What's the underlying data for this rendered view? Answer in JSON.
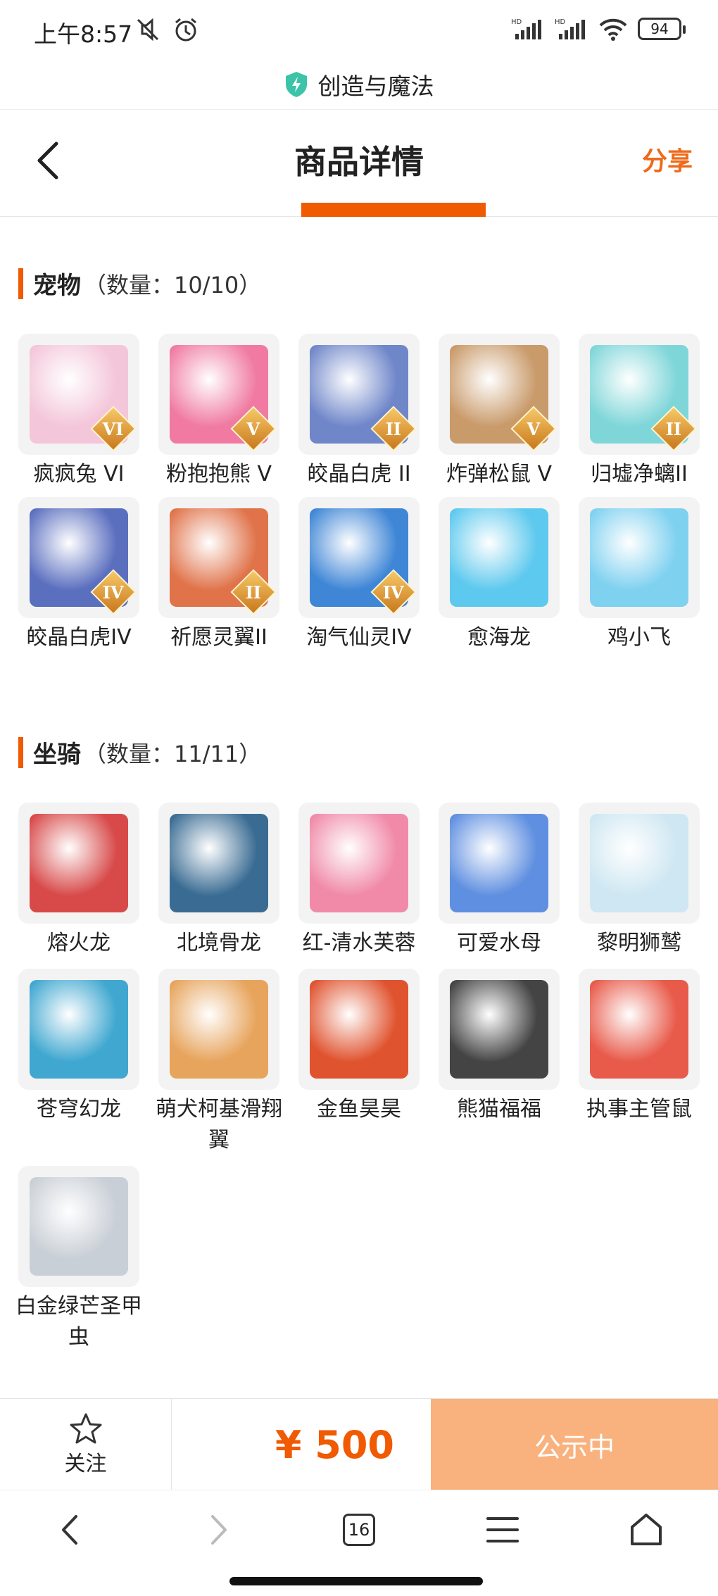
{
  "status_bar": {
    "time": "上午8:57",
    "battery": "94"
  },
  "app": {
    "title": "创造与魔法"
  },
  "header": {
    "title": "商品详情",
    "share_label": "分享"
  },
  "pets": {
    "title": "宠物",
    "count": "（数量：10/10）",
    "items": [
      {
        "name": "疯疯兔 VI",
        "badge": "VI",
        "color": "#f4c6d9"
      },
      {
        "name": "粉抱抱熊 V",
        "badge": "V",
        "color": "#f07aa2"
      },
      {
        "name": "皎晶白虎 II",
        "badge": "II",
        "color": "#6f86c9"
      },
      {
        "name": "炸弹松鼠 V",
        "badge": "V",
        "color": "#c99a6a"
      },
      {
        "name": "归墟净螭II",
        "badge": "II",
        "color": "#7fd6d9"
      },
      {
        "name": "皎晶白虎IV",
        "badge": "IV",
        "color": "#5b6fbf"
      },
      {
        "name": "祈愿灵翼II",
        "badge": "II",
        "color": "#e0734a"
      },
      {
        "name": "淘气仙灵IV",
        "badge": "IV",
        "color": "#3f86d6"
      },
      {
        "name": "愈海龙",
        "badge": "",
        "color": "#5ec9ee"
      },
      {
        "name": "鸡小飞",
        "badge": "",
        "color": "#7fd1f0"
      }
    ]
  },
  "mounts": {
    "title": "坐骑",
    "count": "（数量：11/11）",
    "items": [
      {
        "name": "熔火龙",
        "color": "#d84a4a"
      },
      {
        "name": "北境骨龙",
        "color": "#3a6c93"
      },
      {
        "name": "红-清水芙蓉",
        "color": "#f08aa8"
      },
      {
        "name": "可爱水母",
        "color": "#5f8fe0"
      },
      {
        "name": "黎明狮鹫",
        "color": "#cfe7f2"
      },
      {
        "name": "苍穹幻龙",
        "color": "#3fa7d0"
      },
      {
        "name": "萌犬柯基滑翔翼",
        "color": "#e7a45c"
      },
      {
        "name": "金鱼昊昊",
        "color": "#e0532f"
      },
      {
        "name": "熊猫福福",
        "color": "#444444"
      },
      {
        "name": "执事主管鼠",
        "color": "#e85a4a"
      },
      {
        "name": "白金绿芒圣甲虫",
        "color": "#c9cfd6"
      }
    ]
  },
  "action_bar": {
    "follow_label": "关注",
    "price": "¥ 500",
    "status_label": "公示中"
  },
  "browser": {
    "tabs_count": "16"
  }
}
